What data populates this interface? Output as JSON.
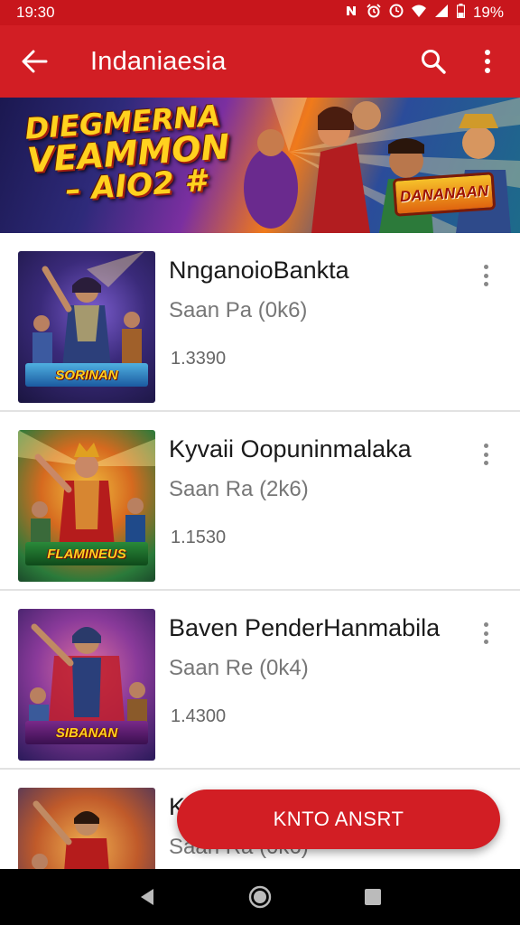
{
  "status_bar": {
    "time": "19:30",
    "battery": "19%"
  },
  "app_bar": {
    "title": "Indaniaesia",
    "back_icon": "arrow-left-icon",
    "search_icon": "search-icon",
    "menu_icon": "more-vert-icon"
  },
  "banner": {
    "line1": "DIEGMERNA",
    "line2": "VEAMMON",
    "line3": "– AIO2 #",
    "logo_text": "DANANAAN"
  },
  "items": [
    {
      "title": "NnganoioBankta",
      "subtitle": "Saan Pa (0k6)",
      "count": "1.3390",
      "thumb_caption": "SORINAN"
    },
    {
      "title": "Kyvaii Oopuninmalaka",
      "subtitle": "Saan Ra (2k6)",
      "count": "1.1530",
      "thumb_caption": "FLAMINEUS"
    },
    {
      "title": "Baven PenderHanmabila",
      "subtitle": "Saan Re (0k4)",
      "count": "1.4300",
      "thumb_caption": "SIBANAN"
    },
    {
      "title": "K",
      "subtitle": "Saan Ra (0k6)",
      "count": "",
      "thumb_caption": ""
    }
  ],
  "fab": {
    "label": "KNTO ANSRT"
  },
  "colors": {
    "primary": "#d21e24",
    "status_bar": "#c8161c",
    "divider": "#e2e2e2"
  }
}
